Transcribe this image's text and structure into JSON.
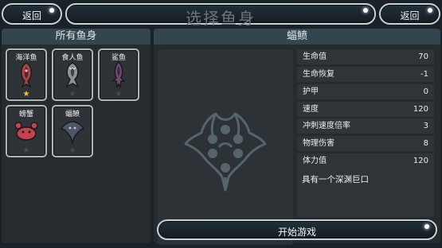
{
  "header": {
    "back_left_label": "返回",
    "title": "选择鱼身",
    "back_right_label": "返回"
  },
  "left_panel": {
    "title": "所有鱼身",
    "cards": [
      {
        "name": "海洋鱼",
        "icon": "ocean-fish-icon",
        "star": "gold"
      },
      {
        "name": "食人鱼",
        "icon": "piranha-icon",
        "star": "dark"
      },
      {
        "name": "鲨鱼",
        "icon": "shark-icon",
        "star": "dark"
      },
      {
        "name": "螃蟹",
        "icon": "crab-icon",
        "star": "dark"
      },
      {
        "name": "蝠鲼",
        "icon": "manta-ray-icon",
        "star": "dark"
      }
    ]
  },
  "right_panel": {
    "title": "蝠鲼",
    "stats": [
      {
        "label": "生命值",
        "value": "70"
      },
      {
        "label": "生命恢复",
        "value": "-1"
      },
      {
        "label": "护甲",
        "value": "0"
      },
      {
        "label": "速度",
        "value": "120"
      },
      {
        "label": "冲刺速度倍率",
        "value": "3"
      },
      {
        "label": "物理伤害",
        "value": "8"
      },
      {
        "label": "体力值",
        "value": "120"
      }
    ],
    "description": "具有一个深渊巨口",
    "start_label": "开始游戏"
  },
  "colors": {
    "star_gold": "#f3c53a",
    "star_dark": "#4a4f3a",
    "fish_ocean": "#a8454a",
    "fish_piranha": "#8d9396",
    "fish_shark": "#6f4870",
    "fish_crab": "#c4434f",
    "fish_manta": "#4d556b"
  }
}
